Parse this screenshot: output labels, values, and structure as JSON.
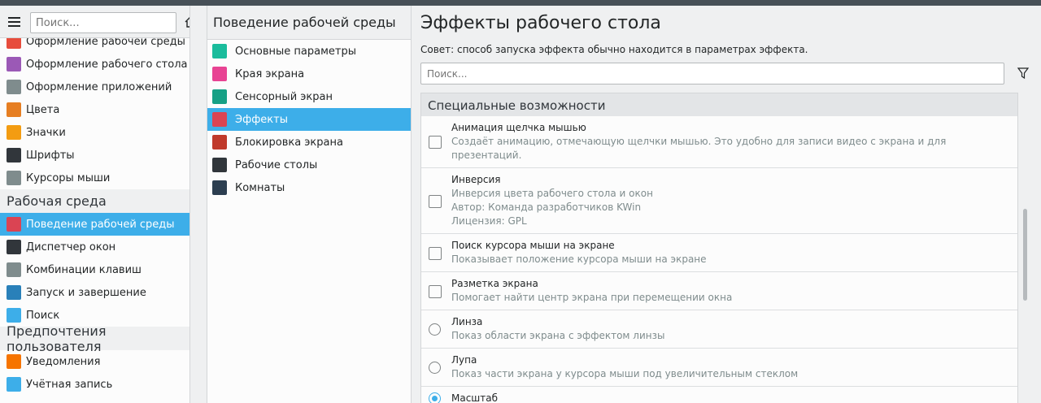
{
  "sidebar": {
    "search_placeholder": "Поиск...",
    "items_top": [
      {
        "label": "Оформление рабочей среды",
        "icon": "workspace-theme-icon",
        "color": "#e74c3c"
      },
      {
        "label": "Оформление рабочего стола",
        "icon": "desktop-theme-icon",
        "color": "#9b59b6"
      },
      {
        "label": "Оформление приложений",
        "icon": "app-style-icon",
        "color": "#7f8c8d"
      },
      {
        "label": "Цвета",
        "icon": "colors-icon",
        "color": "#e67e22"
      },
      {
        "label": "Значки",
        "icon": "icons-icon",
        "color": "#f39c12"
      },
      {
        "label": "Шрифты",
        "icon": "fonts-icon",
        "color": "#31363b"
      },
      {
        "label": "Курсоры мыши",
        "icon": "cursor-icon",
        "color": "#7f8c8d"
      }
    ],
    "section_workspace": "Рабочая среда",
    "items_workspace": [
      {
        "label": "Поведение рабочей среды",
        "icon": "workspace-behavior-icon",
        "color": "#da4453"
      },
      {
        "label": "Диспетчер окон",
        "icon": "window-manager-icon",
        "color": "#31363b"
      },
      {
        "label": "Комбинации клавиш",
        "icon": "shortcuts-icon",
        "color": "#7f8c8d"
      },
      {
        "label": "Запуск и завершение",
        "icon": "startup-icon",
        "color": "#2980b9"
      },
      {
        "label": "Поиск",
        "icon": "search-icon",
        "color": "#3daee9"
      }
    ],
    "section_user": "Предпочтения пользователя",
    "items_user": [
      {
        "label": "Уведомления",
        "icon": "notifications-icon",
        "color": "#f67400"
      },
      {
        "label": "Учётная запись",
        "icon": "account-icon",
        "color": "#3daee9"
      }
    ]
  },
  "middle": {
    "title": "Поведение рабочей среды",
    "items": [
      {
        "label": "Основные параметры",
        "icon": "general-icon",
        "color": "#1abc9c"
      },
      {
        "label": "Края экрана",
        "icon": "screen-edges-icon",
        "color": "#e84393"
      },
      {
        "label": "Сенсорный экран",
        "icon": "touchscreen-icon",
        "color": "#16a085"
      },
      {
        "label": "Эффекты",
        "icon": "effects-icon",
        "color": "#da4453"
      },
      {
        "label": "Блокировка экрана",
        "icon": "lock-screen-icon",
        "color": "#c0392b"
      },
      {
        "label": "Рабочие столы",
        "icon": "virtual-desktops-icon",
        "color": "#31363b"
      },
      {
        "label": "Комнаты",
        "icon": "activities-icon",
        "color": "#2c3e50"
      }
    ]
  },
  "main": {
    "title": "Эффекты рабочего стола",
    "hint": "Совет: способ запуска эффекта обычно находится в параметрах эффекта.",
    "search_placeholder": "Поиск...",
    "category": "Специальные возможности",
    "effects": [
      {
        "name": "Анимация щелчка мышью",
        "desc": [
          "Создаёт анимацию, отмечающую щелчки мышью. Это удобно для записи видео с экрана и для презентаций."
        ],
        "control": "checkbox",
        "checked": false
      },
      {
        "name": "Инверсия",
        "desc": [
          "Инверсия цвета рабочего стола и окон",
          "Автор: Команда разработчиков KWin",
          "Лицензия: GPL"
        ],
        "control": "checkbox",
        "checked": false
      },
      {
        "name": "Поиск курсора мыши на экране",
        "desc": [
          "Показывает положение курсора мыши на экране"
        ],
        "control": "checkbox",
        "checked": false
      },
      {
        "name": "Разметка экрана",
        "desc": [
          "Помогает найти центр экрана при перемещении окна"
        ],
        "control": "checkbox",
        "checked": false
      },
      {
        "name": "Линза",
        "desc": [
          "Показ области экрана с эффектом линзы"
        ],
        "control": "radio",
        "checked": false
      },
      {
        "name": "Лупа",
        "desc": [
          "Показ части экрана у курсора мыши под увеличительным стеклом"
        ],
        "control": "radio",
        "checked": false
      },
      {
        "name": "Масштаб",
        "desc": [],
        "control": "radio",
        "checked": true
      }
    ]
  },
  "colors": {
    "accent": "#3daee9"
  }
}
